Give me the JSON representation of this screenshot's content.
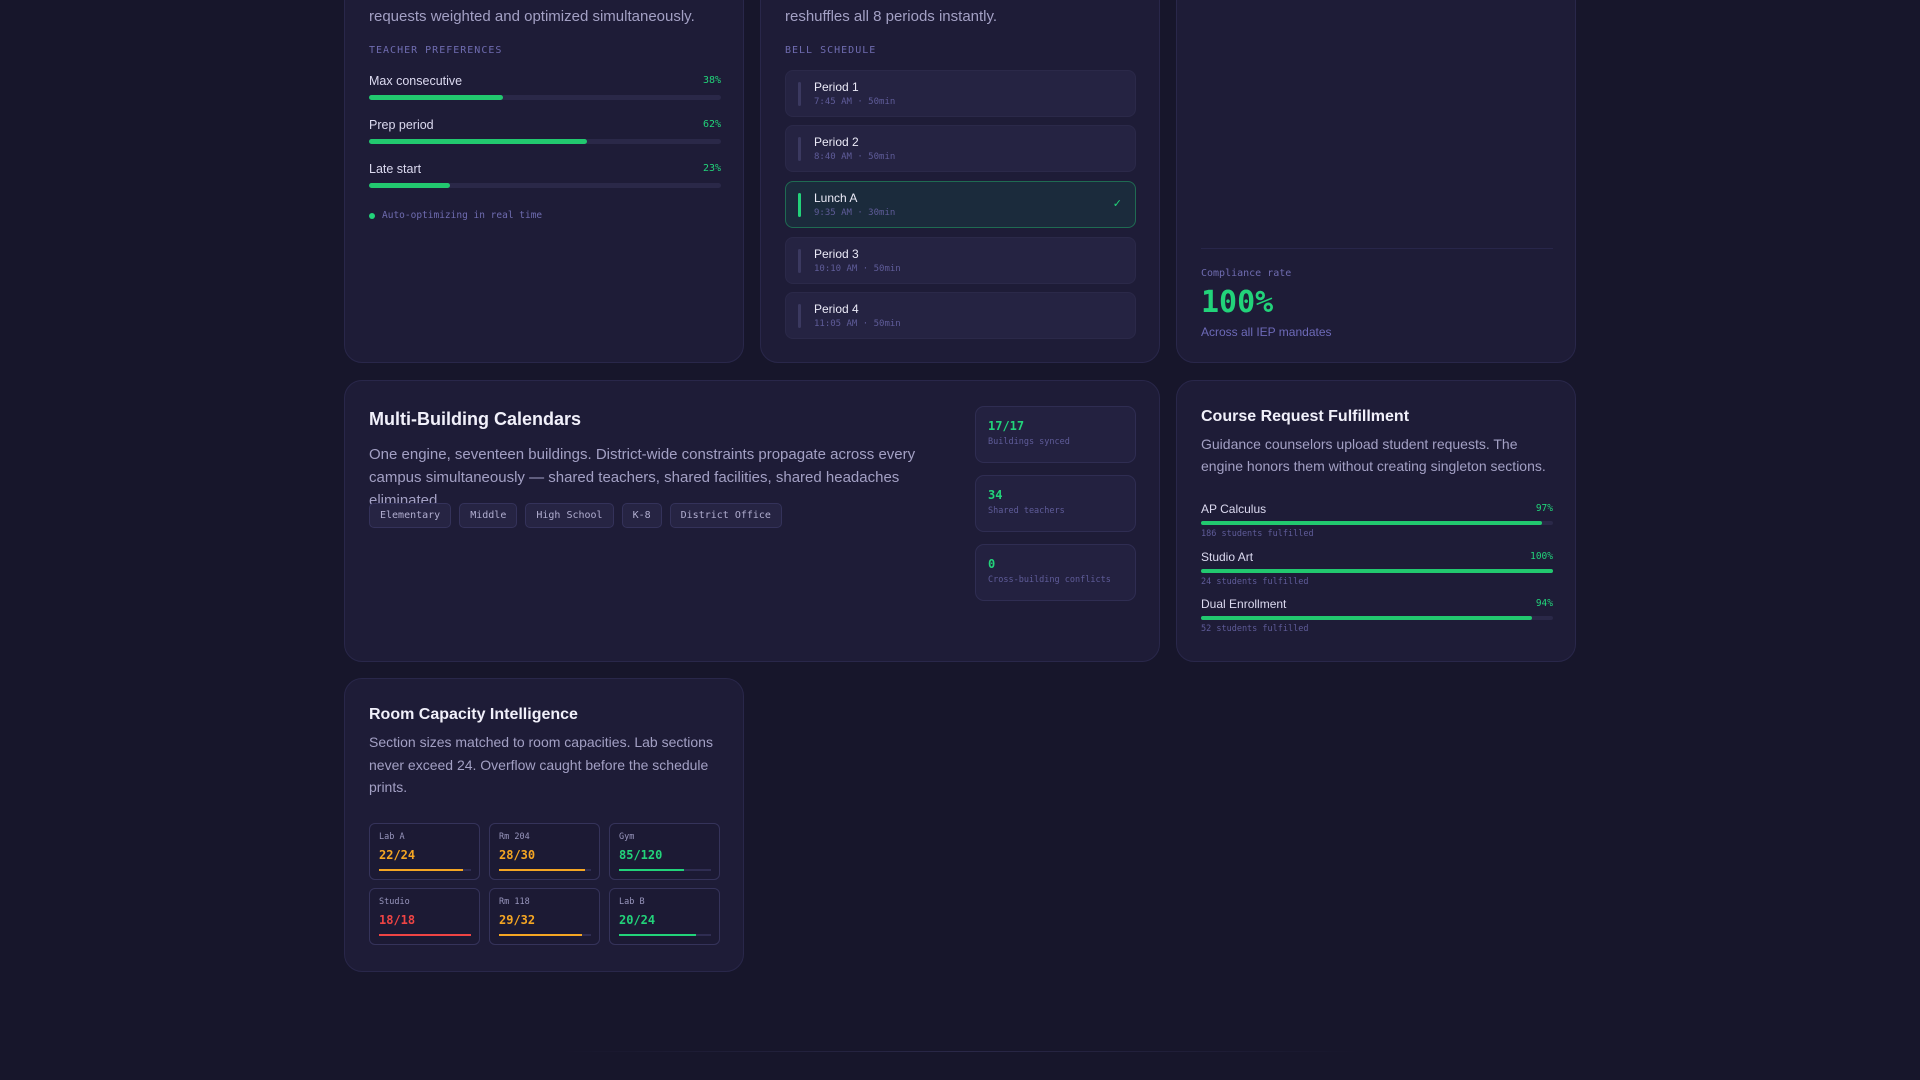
{
  "colors": {
    "background": "#17162b",
    "card": "#1e1c37",
    "accent_green": "#22d37a",
    "warning_orange": "#f5a623",
    "danger_red": "#ef4444",
    "label_purple": "#6f6cb0"
  },
  "prefs_card": {
    "intro": "requests weighted and optimized simultaneously.",
    "section_label": "TEACHER PREFERENCES",
    "items": [
      {
        "name": "Max consecutive",
        "pct_label": "38%",
        "fraction": 0.38
      },
      {
        "name": "Prep period",
        "pct_label": "62%",
        "fraction": 0.62
      },
      {
        "name": "Late start",
        "pct_label": "23%",
        "fraction": 0.23
      }
    ],
    "status_note": "Auto-optimizing in real time"
  },
  "bell_card": {
    "intro": "reshuffles all 8 periods instantly.",
    "section_label": "BELL SCHEDULE",
    "periods": [
      {
        "name": "Period 1",
        "time": "7:45 AM · 50min",
        "active": false
      },
      {
        "name": "Period 2",
        "time": "8:40 AM · 50min",
        "active": false
      },
      {
        "name": "Lunch A",
        "time": "9:35 AM · 30min",
        "active": true,
        "check": "✓"
      },
      {
        "name": "Period 3",
        "time": "10:10 AM · 50min",
        "active": false
      },
      {
        "name": "Period 4",
        "time": "11:05 AM · 50min",
        "active": false
      }
    ]
  },
  "iep_card": {
    "label": "Compliance rate",
    "value": "100%",
    "sub": "Across all IEP mandates"
  },
  "multi_card": {
    "title": "Multi-Building Calendars",
    "description": "One engine, seventeen buildings. District-wide constraints propagate across every campus simultaneously — shared teachers, shared facilities, shared headaches eliminated.",
    "tags": [
      "Elementary",
      "Middle",
      "High School",
      "K-8",
      "District Office"
    ],
    "stats": [
      {
        "value": "17/17",
        "label": "Buildings synced"
      },
      {
        "value": "34",
        "label": "Shared teachers"
      },
      {
        "value": "0",
        "label": "Cross-building conflicts"
      }
    ]
  },
  "course_card": {
    "title": "Course Request Fulfillment",
    "description": "Guidance counselors upload student requests. The engine honors them without creating singleton sections.",
    "courses": [
      {
        "name": "AP Calculus",
        "pct_label": "97%",
        "fraction": 0.97,
        "sub": "186 students fulfilled"
      },
      {
        "name": "Studio Art",
        "pct_label": "100%",
        "fraction": 1.0,
        "sub": "24 students fulfilled"
      },
      {
        "name": "Dual Enrollment",
        "pct_label": "94%",
        "fraction": 0.94,
        "sub": "52 students fulfilled"
      }
    ]
  },
  "room_card": {
    "title": "Room Capacity Intelligence",
    "description": "Section sizes matched to room capacities. Lab sections never exceed 24. Overflow caught before the schedule prints.",
    "rooms": [
      {
        "name": "Lab A",
        "value": "22/24",
        "fraction": 0.917,
        "status": "warning"
      },
      {
        "name": "Rm 204",
        "value": "28/30",
        "fraction": 0.933,
        "status": "warning"
      },
      {
        "name": "Gym",
        "value": "85/120",
        "fraction": 0.708,
        "status": "ok"
      },
      {
        "name": "Studio",
        "value": "18/18",
        "fraction": 1.0,
        "status": "full"
      },
      {
        "name": "Rm 118",
        "value": "29/32",
        "fraction": 0.906,
        "status": "warning"
      },
      {
        "name": "Lab B",
        "value": "20/24",
        "fraction": 0.833,
        "status": "ok"
      }
    ]
  }
}
